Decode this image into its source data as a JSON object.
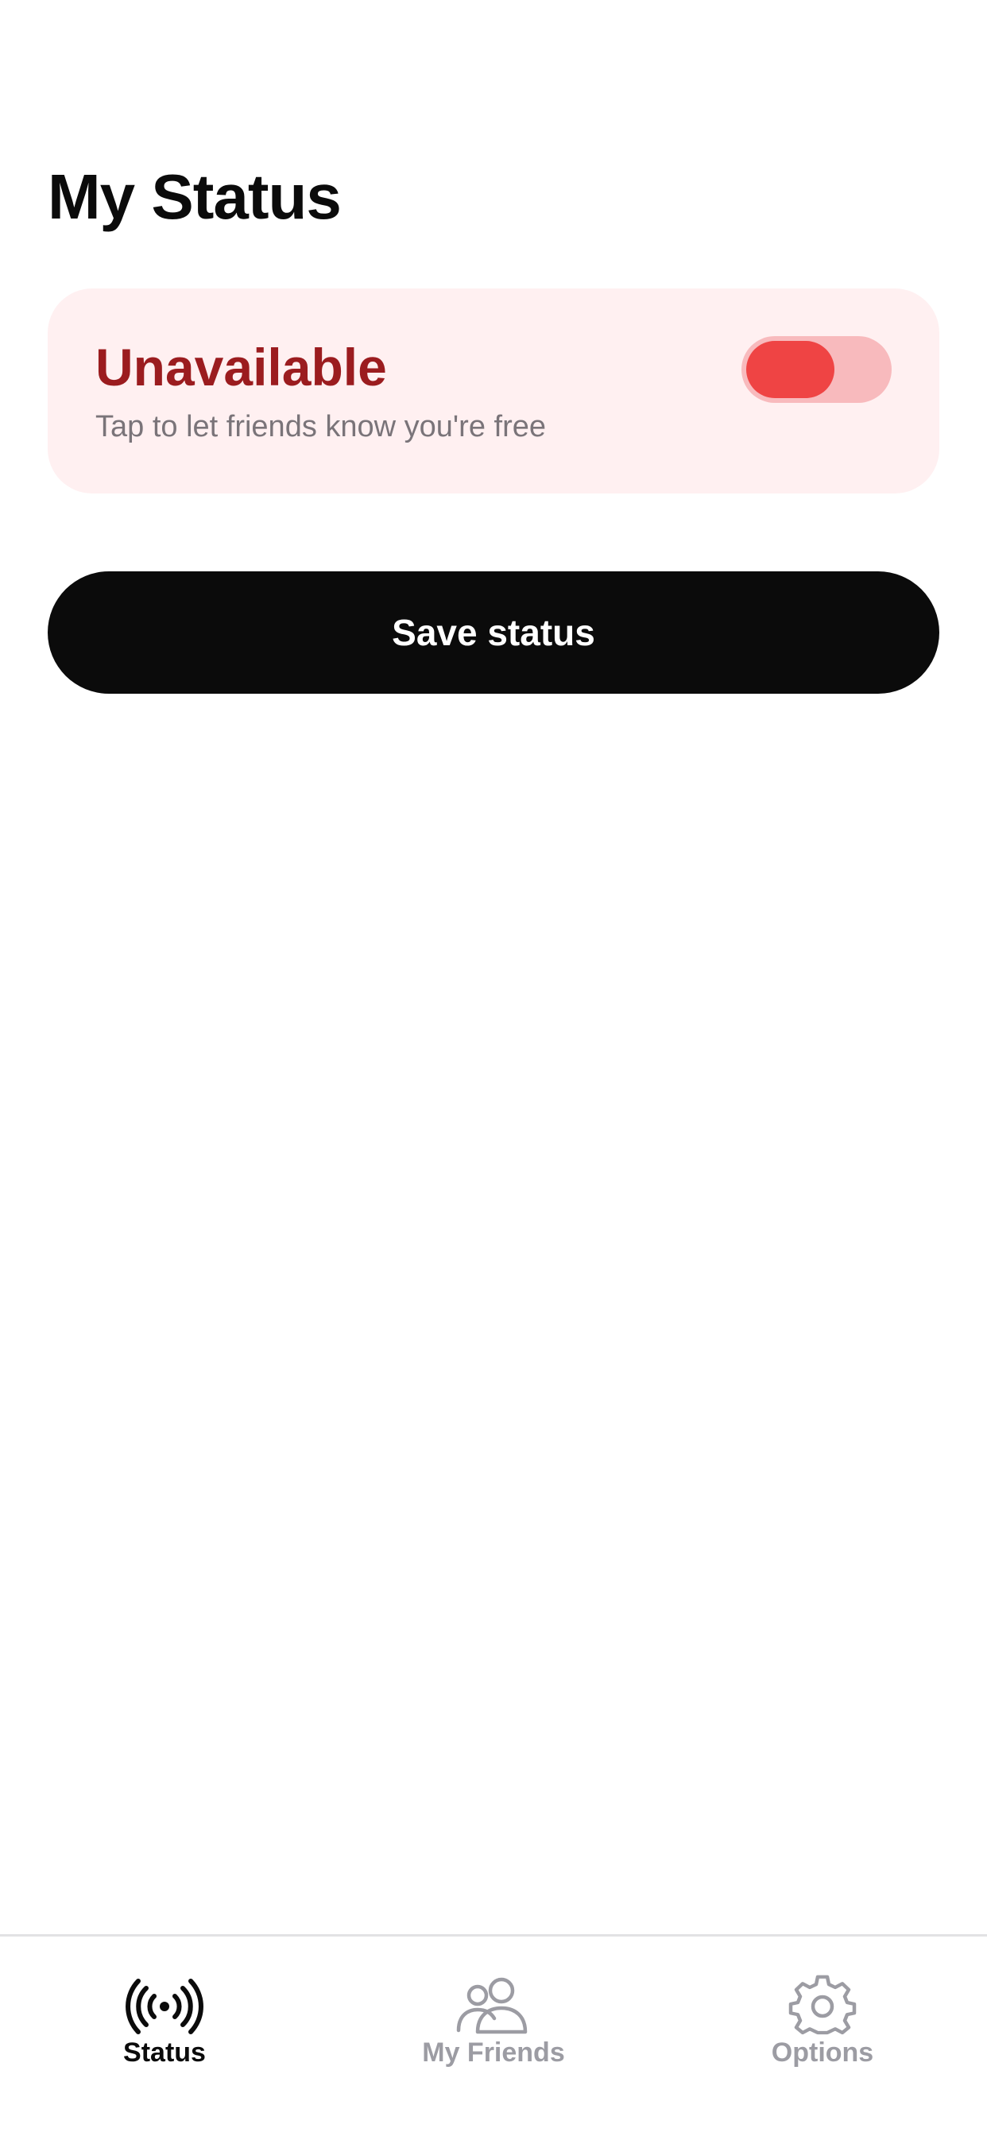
{
  "page": {
    "title": "My Status"
  },
  "status_card": {
    "heading": "Unavailable",
    "subtext": "Tap to let friends know you're free",
    "toggle_on": false,
    "colors": {
      "background": "#fff0f1",
      "heading": "#9b1c1f",
      "subtext": "#7a7479",
      "toggle_track": "#f8babd",
      "toggle_knob": "#ef4444"
    }
  },
  "save_button": {
    "label": "Save status",
    "colors": {
      "background": "#0b0b0b",
      "text": "#ffffff"
    }
  },
  "tab_bar": {
    "active_color": "#0b0b0b",
    "inactive_color": "#9c9ca3",
    "tabs": [
      {
        "label": "Status",
        "icon": "broadcast-icon",
        "active": true
      },
      {
        "label": "My Friends",
        "icon": "users-icon",
        "active": false
      },
      {
        "label": "Options",
        "icon": "gear-icon",
        "active": false
      }
    ]
  }
}
